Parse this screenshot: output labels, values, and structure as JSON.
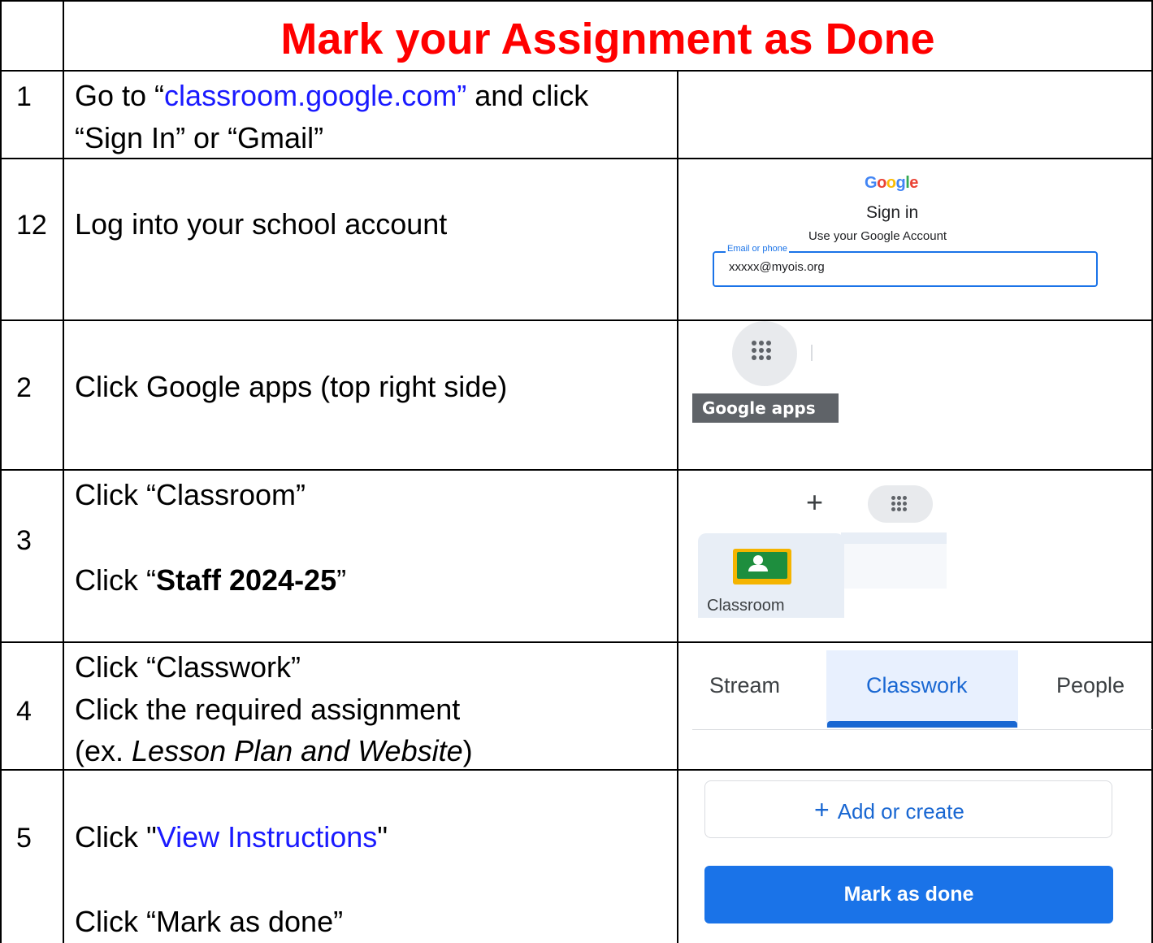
{
  "title": "Mark your Assignment as Done",
  "rows": [
    {
      "number": "1",
      "line1_prefix": "Go to “",
      "line1_link": "classroom.google.com”",
      "line1_suffix": " and click",
      "line2": "“Sign In” or “Gmail”"
    },
    {
      "number": "12",
      "text": "Log into your school account",
      "signin": {
        "logo": [
          "G",
          "o",
          "o",
          "g",
          "l",
          "e"
        ],
        "logo_colors": [
          "#4285f4",
          "#ea4335",
          "#fbbc05",
          "#4285f4",
          "#34a853",
          "#ea4335"
        ],
        "heading": "Sign in",
        "subheading": "Use your Google Account",
        "field_label": "Email or phone",
        "field_value": "xxxxx@myois.org"
      }
    },
    {
      "number": "2",
      "text": "Click Google apps (top right side)",
      "tooltip": "Google apps",
      "icon": "apps-grid-icon"
    },
    {
      "number": "3",
      "line1": "Click “Classroom”",
      "line2_prefix": "Click “",
      "line2_bold": "Staff 2024-25",
      "line2_suffix": "”",
      "plus": "+",
      "tile_label": "Classroom"
    },
    {
      "number": "4",
      "line1": "Click “Classwork”",
      "line2": "Click the required assignment",
      "line3_prefix": "(ex. ",
      "line3_italic": "Lesson Plan and Website",
      "line3_suffix": ")",
      "tabs": [
        "Stream",
        "Classwork",
        "People"
      ],
      "active_tab": "Classwork"
    },
    {
      "number": "5",
      "line1_prefix": "Click \"",
      "line1_link": "View Instructions",
      "line1_suffix": "\"",
      "line2": "Click “Mark as done”",
      "add_button": "Add or create",
      "add_icon": "+",
      "done_button": "Mark as done"
    }
  ]
}
